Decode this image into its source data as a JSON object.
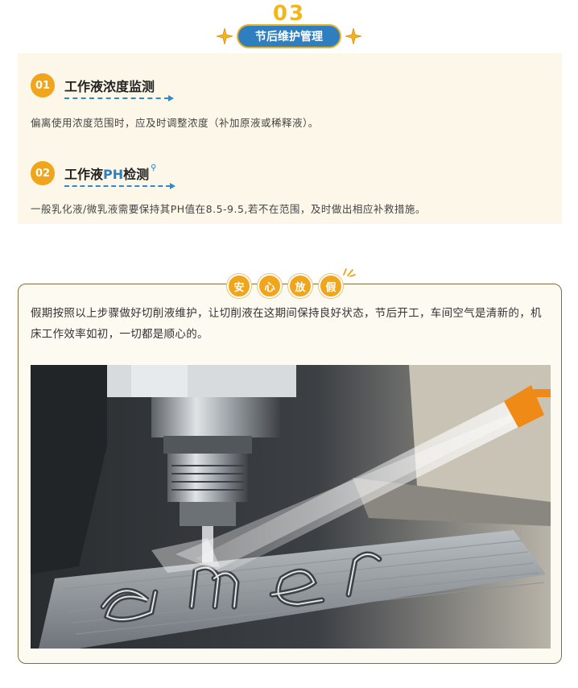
{
  "section": {
    "number": "03",
    "title": "节后维护管理"
  },
  "items": [
    {
      "badge": "01",
      "title": "工作液浓度监测",
      "text": "偏离使用浓度范围时，应及时调整浓度（补加原液或稀释液）。"
    },
    {
      "badge": "02",
      "title_prefix": "工作液",
      "title_highlight": "PH",
      "title_suffix": "检测",
      "text": "一般乳化液/微乳液需要保持其PH值在8.5-9.5,若不在范围，及时做出相应补救措施。"
    }
  ],
  "holiday": {
    "chars": [
      "安",
      "心",
      "放",
      "假"
    ],
    "paragraph": "假期按照以上步骤做好切削液维护，让切削液在这期间保持良好状态，节后开工，车间空气是清新的，机床工作效率如初，一切都是顺心的。",
    "photo_engraving": "amer"
  },
  "colors": {
    "accent_orange": "#f0a51a",
    "accent_blue": "#2f7fc0",
    "panel_bg": "#fcf7e8",
    "card_border": "#8b6a3e"
  },
  "icons": {
    "star": "four-point-star-icon",
    "magnifier": "magnifier-icon",
    "sparkle": "sparkle-lines-icon"
  }
}
